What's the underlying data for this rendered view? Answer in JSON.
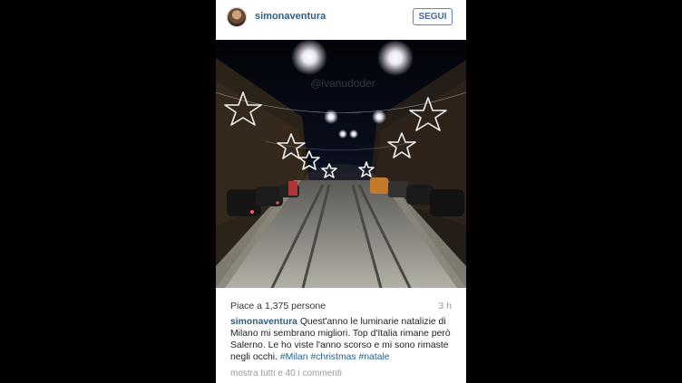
{
  "post": {
    "username": "simonaventura",
    "follow_label": "SEGUI",
    "watermark": "@ivanudoder",
    "likes_text": "Piace a 1,375 persone",
    "time": "3 h",
    "caption": {
      "username": "simonaventura",
      "text": "Quest'anno le luminarie natalizie di Milano mi sembrano migliori. Top d'Italia rimane però Salerno. Le ho viste l'anno scorso e mi sono rimaste negli occhi.",
      "hashtags": [
        "#Milan",
        "#christmas",
        "#natale"
      ]
    },
    "more_comments": "mostra tutti e 40 i commenti"
  }
}
